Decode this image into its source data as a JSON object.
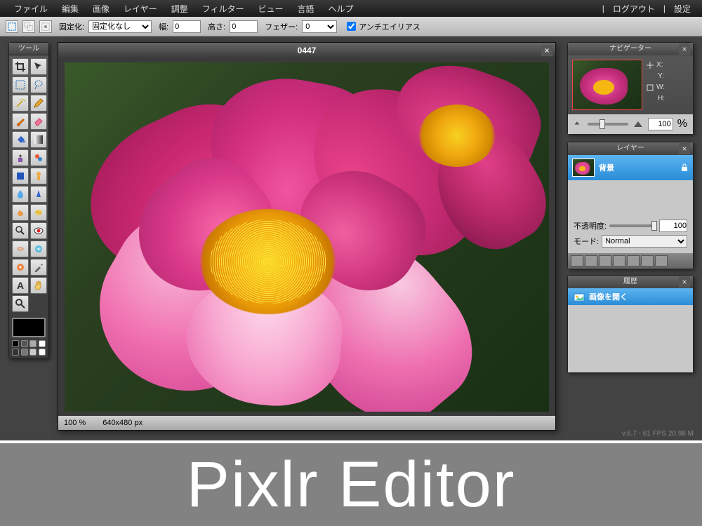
{
  "menu": {
    "file": "ファイル",
    "edit": "編集",
    "image": "画像",
    "layer": "レイヤー",
    "adjust": "調整",
    "filter": "フィルター",
    "view": "ビュー",
    "language": "言語",
    "help": "ヘルプ",
    "logout": "ログアウト",
    "settings": "設定"
  },
  "options": {
    "lock_label": "固定化:",
    "lock_value": "固定化なし",
    "width_label": "幅:",
    "width_value": "0",
    "height_label": "高さ:",
    "height_value": "0",
    "feather_label": "フェザー:",
    "feather_value": "0",
    "antialias_label": "アンチエイリアス"
  },
  "tools_panel": {
    "title": "ツール"
  },
  "canvas": {
    "title": "0447",
    "zoom": "100 %",
    "dims": "640x480 px"
  },
  "navigator": {
    "title": "ナビゲーター",
    "x_label": "X:",
    "y_label": "Y:",
    "w_label": "W:",
    "h_label": "H:",
    "zoom_value": "100",
    "zoom_suffix": "%"
  },
  "layers": {
    "title": "レイヤー",
    "bg_layer": "背景",
    "opacity_label": "不透明度:",
    "opacity_value": "100",
    "mode_label": "モード:",
    "mode_value": "Normal"
  },
  "history": {
    "title": "履歴",
    "open_image": "画像を開く"
  },
  "version": "v.6.7 - 61 FPS 20.98 M",
  "banner": "Pixlr Editor"
}
